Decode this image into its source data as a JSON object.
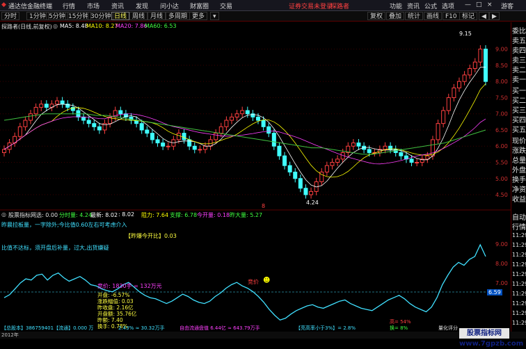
{
  "menubar": {
    "app_title": "通达信金融终端",
    "menus": [
      "行情",
      "市场",
      "资讯",
      "发现",
      "问小达",
      "财富圈",
      "交易"
    ],
    "notice": "证券交易未登录",
    "user": "探路者",
    "right": [
      "功能",
      "资讯",
      "公式",
      "选项"
    ],
    "guest": "游客"
  },
  "toolbar": {
    "periods": [
      "分时",
      "1分钟",
      "5分钟",
      "15分钟",
      "30分钟",
      "日线",
      "周线",
      "月线",
      "多周期",
      "更多"
    ],
    "active_period": "日线",
    "right": [
      "复权",
      "叠加",
      "统计",
      "画线",
      "F10",
      "标记"
    ]
  },
  "main_chart": {
    "stock_title": "探路者(日线,前复权)",
    "ma": [
      {
        "label": "MA5: 8.48",
        "color": "#ffffff"
      },
      {
        "label": "MA10: 8.27",
        "color": "#ffff00"
      },
      {
        "label": "MA20: 7.86",
        "color": "#ff40ff"
      },
      {
        "label": "MA60: 6.53",
        "color": "#40ff40"
      }
    ],
    "high_label": "9.15",
    "low_label": "4.24",
    "axis": [
      "9.00",
      "8.50",
      "8.00",
      "7.50",
      "7.00",
      "6.50",
      "6.00",
      "5.50",
      "5.00",
      "4.50"
    ],
    "marker": "8"
  },
  "indicator": {
    "title": "股票指标网",
    "sel": "选: 0.00",
    "stats": [
      {
        "label": "分时量: 4.24",
        "color": "#40ff40"
      },
      {
        "label": "最新: 8.02",
        "color": "#ffffff"
      },
      {
        "label": ": 8.02",
        "color": "#ffffff"
      },
      {
        "label": "阻力: 7.64",
        "color": "#ffff00"
      },
      {
        "label": "支撑: 6.78",
        "color": "#40ff40"
      },
      {
        "label": "今开量: 0.18",
        "color": "#ff40ff"
      },
      {
        "label": "昨大量: 5.27",
        "color": "#40ff40"
      }
    ],
    "notes": [
      "昨晨拉板量，一字除外;今比值0.60左右可考虑介入",
      "【昨爆今开比】0.03",
      "比值不达标，须开盘后补量，过大,出货嫌疑"
    ],
    "auction_label": "竞价: 1830手 = 132万元",
    "tag": "竞价",
    "stats_box": [
      "开盘:  -6.57%",
      "涨跌幅值: 0.03",
      "昨收盘: 2.16亿",
      "开盘额: 35.76亿",
      "昨额: 7.40",
      "换手: 0.78%"
    ],
    "bottom": [
      "【总股本】386759401【流通】0.000 万",
      "2.43% ≈ 30.32万手",
      "自由流通盘值 6.44亿 ≈ 643.79万手",
      "【亮高率小于3%】= 2.8%",
      "高= 54%",
      "换= 8%",
      "量化评分"
    ],
    "axis": [
      "9.00",
      "8.00",
      "7.00"
    ],
    "current_value": "6.59"
  },
  "sidebar": {
    "items": [
      "委比",
      "卖五",
      "卖四",
      "卖三",
      "卖二",
      "卖一",
      "买一",
      "买二",
      "买三",
      "买四",
      "买五",
      "现价",
      "涨跌",
      "总量",
      "外盘",
      "换手",
      "净资",
      "收益",
      "自动",
      "行情"
    ],
    "times": [
      "11:29",
      "11:29",
      "11:29",
      "11:29",
      "11:29",
      "11:29",
      "11:29",
      "11:29",
      "11:29",
      "11:29"
    ]
  },
  "statusbar": {
    "year": "2012年"
  },
  "watermark": {
    "text": "股票指标网 www.7gpzb.com"
  },
  "chart_data": {
    "type": "candlestick",
    "title": "探路者(日线,前复权)",
    "ylim": [
      4.2,
      9.4
    ],
    "yticks": [
      4.5,
      5.0,
      5.5,
      6.0,
      6.5,
      7.0,
      7.5,
      8.0,
      8.5,
      9.0
    ],
    "close": [
      5.9,
      6.1,
      6.3,
      6.6,
      6.8,
      7.0,
      7.2,
      7.3,
      7.2,
      7.3,
      7.4,
      7.3,
      7.2,
      7.1,
      6.9,
      6.8,
      6.7,
      6.6,
      6.5,
      6.7,
      6.9,
      7.1,
      7.0,
      6.9,
      6.8,
      6.7,
      6.5,
      6.4,
      6.2,
      6.1,
      6.0,
      6.0,
      6.2,
      6.4,
      6.2,
      6.0,
      5.9,
      5.9,
      6.0,
      6.2,
      6.4,
      6.6,
      6.8,
      6.9,
      7.0,
      7.1,
      7.0,
      6.9,
      6.8,
      6.6,
      6.4,
      6.0,
      5.7,
      5.4,
      5.2,
      5.0,
      4.7,
      4.5,
      4.6,
      4.9,
      5.2,
      5.4,
      5.5,
      5.6,
      5.8,
      6.0,
      6.1,
      6.0,
      5.9,
      5.8,
      5.8,
      5.9,
      6.0,
      5.9,
      5.8,
      5.7,
      5.6,
      5.5,
      5.5,
      5.6,
      5.7,
      6.2,
      6.7,
      7.1,
      7.5,
      7.8,
      8.0,
      8.2,
      8.4,
      8.6,
      9.0,
      8.0
    ],
    "ma60": [
      6.8,
      6.85,
      6.9,
      6.95,
      7.0,
      7.0,
      7.0,
      7.0,
      7.0,
      6.95,
      6.95,
      6.9,
      6.85,
      6.8,
      6.75,
      6.7,
      6.65,
      6.6,
      6.55,
      6.5,
      6.45,
      6.4,
      6.35,
      6.3,
      6.25,
      6.2,
      6.15,
      6.1,
      6.05,
      6.0,
      5.95,
      5.95,
      5.9,
      5.85,
      5.8,
      5.75,
      5.75,
      5.8,
      5.85,
      5.9,
      5.95,
      6.0,
      6.05,
      6.1,
      6.2,
      6.3,
      6.4,
      6.5
    ],
    "indicator_line": [
      0.4,
      0.45,
      0.55,
      0.65,
      0.72,
      0.7,
      0.78,
      0.8,
      0.7,
      0.78,
      0.82,
      0.74,
      0.68,
      0.72,
      0.76,
      0.7,
      0.62,
      0.6,
      0.55,
      0.52,
      0.5,
      0.55,
      0.62,
      0.66,
      0.58,
      0.5,
      0.44,
      0.4,
      0.38,
      0.34,
      0.3,
      0.34,
      0.4,
      0.46,
      0.42,
      0.36,
      0.32,
      0.3,
      0.34,
      0.42,
      0.48,
      0.56,
      0.62,
      0.66,
      0.6,
      0.56,
      0.5,
      0.42,
      0.32,
      0.2,
      0.1,
      0.02,
      0.05,
      0.12,
      0.18,
      0.22,
      0.26,
      0.28,
      0.24,
      0.22,
      0.26,
      0.3,
      0.34,
      0.36,
      0.3,
      0.26,
      0.22,
      0.2,
      0.18,
      0.24,
      0.3,
      0.36,
      0.4,
      0.44,
      0.38,
      0.3,
      0.24,
      0.2,
      0.16,
      0.24,
      0.4,
      0.62,
      0.78,
      0.92,
      1.0,
      0.95,
      1.05,
      1.1,
      1.3,
      1.1
    ]
  }
}
